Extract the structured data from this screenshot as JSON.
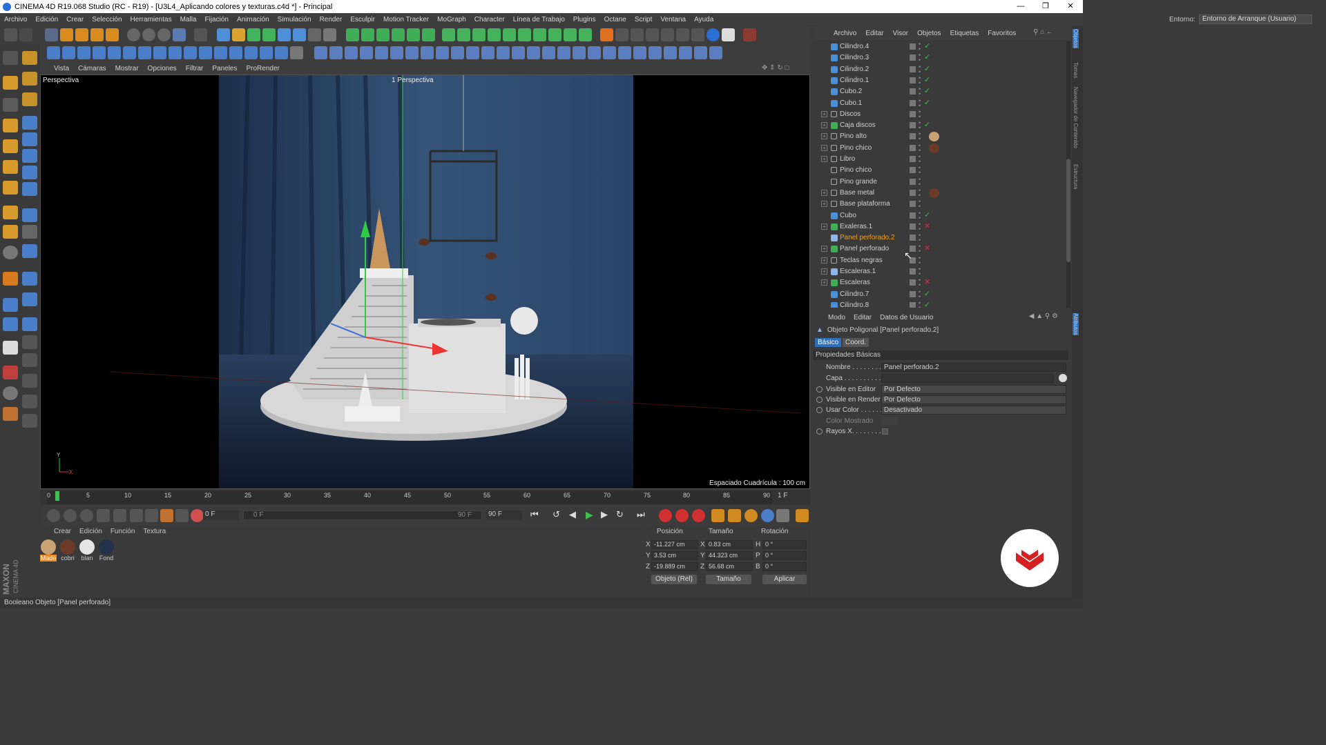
{
  "title": "CINEMA 4D R19.068 Studio (RC - R19) - [U3L4_Aplicando colores y texturas.c4d *] - Principal",
  "menu": [
    "Archivo",
    "Edición",
    "Crear",
    "Selección",
    "Herramientas",
    "Malla",
    "Fijación",
    "Animación",
    "Simulación",
    "Render",
    "Esculpir",
    "Motion Tracker",
    "MoGraph",
    "Character",
    "Línea de Trabajo",
    "Plugins",
    "Octane",
    "Script",
    "Ventana",
    "Ayuda"
  ],
  "env": {
    "label": "Entorno:",
    "value": "Entorno de Arranque (Usuario)"
  },
  "viewport_menu": [
    "Vista",
    "Cámaras",
    "Mostrar",
    "Opciones",
    "Filtrar",
    "Paneles",
    "ProRender"
  ],
  "viewport": {
    "name": "Perspectiva",
    "camera": "1 Perspectiva",
    "grid": "Espaciado Cuadrícula : 100 cm"
  },
  "timeline": {
    "ticks": [
      "0",
      "5",
      "10",
      "15",
      "20",
      "25",
      "30",
      "35",
      "40",
      "45",
      "50",
      "55",
      "60",
      "65",
      "70",
      "75",
      "80",
      "85",
      "90"
    ],
    "current": "1 F"
  },
  "transport": {
    "start": "0 F",
    "range_start": "0 F",
    "range_end": "90 F",
    "end": "90 F"
  },
  "materials": {
    "menu": [
      "Crear",
      "Edición",
      "Función",
      "Textura"
    ],
    "items": [
      {
        "label": "Made",
        "color": "#c9a274"
      },
      {
        "label": "cobri",
        "color": "#6b3a28"
      },
      {
        "label": "blan",
        "color": "#e4e4e4"
      },
      {
        "label": "Fond",
        "color": "#22324c"
      }
    ]
  },
  "coords": {
    "headers": [
      "Posición",
      "Tamaño",
      "Rotación"
    ],
    "rows": [
      {
        "axis": "X",
        "pos": "-11.227 cm",
        "saxis": "X",
        "size": "0.83 cm",
        "raxis": "H",
        "rot": "0 °"
      },
      {
        "axis": "Y",
        "pos": "3.53 cm",
        "saxis": "Y",
        "size": "44.323 cm",
        "raxis": "P",
        "rot": "0 °"
      },
      {
        "axis": "Z",
        "pos": "-19.889 cm",
        "saxis": "Z",
        "size": "56.68 cm",
        "raxis": "B",
        "rot": "0 °"
      }
    ],
    "mode": "Objeto (Rel)",
    "size_mode": "Tamaño",
    "apply": "Aplicar"
  },
  "status": "Booleano Objeto [Panel perforado]",
  "objects": {
    "menu": [
      "Archivo",
      "Editar",
      "Visor",
      "Objetos",
      "Etiquetas",
      "Favoritos"
    ],
    "items": [
      {
        "name": "Cilindro.4",
        "type": "prim",
        "exp": false,
        "tag": "check"
      },
      {
        "name": "Cilindro.3",
        "type": "prim",
        "exp": false,
        "tag": "check"
      },
      {
        "name": "Cilindro.2",
        "type": "prim",
        "exp": false,
        "tag": "check"
      },
      {
        "name": "Cilindro.1",
        "type": "prim",
        "exp": false,
        "tag": "check"
      },
      {
        "name": "Cubo.2",
        "type": "prim",
        "exp": false,
        "tag": "check"
      },
      {
        "name": "Cubo.1",
        "type": "prim",
        "exp": false,
        "tag": "check"
      },
      {
        "name": "Discos",
        "type": "null",
        "exp": true,
        "tag": ""
      },
      {
        "name": "Caja discos",
        "type": "gen",
        "exp": true,
        "tag": "check"
      },
      {
        "name": "Pino alto",
        "type": "null",
        "exp": true,
        "tag": "",
        "thumb": "#c9a274"
      },
      {
        "name": "Pino chico",
        "type": "null",
        "exp": true,
        "tag": "",
        "thumb": "#6b3a28"
      },
      {
        "name": "Libro",
        "type": "null",
        "exp": true,
        "tag": ""
      },
      {
        "name": "Pino chico",
        "type": "null",
        "exp": false,
        "tag": ""
      },
      {
        "name": "Pino grande",
        "type": "null",
        "exp": false,
        "tag": ""
      },
      {
        "name": "Base metal",
        "type": "null",
        "exp": true,
        "tag": "",
        "thumb": "#6b3a28"
      },
      {
        "name": "Base plataforma",
        "type": "null",
        "exp": true,
        "tag": ""
      },
      {
        "name": "Cubo",
        "type": "prim",
        "exp": false,
        "tag": "check"
      },
      {
        "name": "Exaleras.1",
        "type": "gen",
        "exp": true,
        "tag": "cross"
      },
      {
        "name": "Panel perforado.2",
        "type": "poly",
        "exp": false,
        "tag": "",
        "selected": true
      },
      {
        "name": "Panel perforado",
        "type": "bool",
        "exp": true,
        "tag": "cross"
      },
      {
        "name": "Teclas negras",
        "type": "null",
        "exp": true,
        "tag": ""
      },
      {
        "name": "Escaleras.1",
        "type": "poly",
        "exp": true,
        "tag": ""
      },
      {
        "name": "Escaleras",
        "type": "gen",
        "exp": true,
        "tag": "cross"
      },
      {
        "name": "Cilindro.7",
        "type": "prim",
        "exp": false,
        "tag": "check"
      },
      {
        "name": "Cilindro.8",
        "type": "prim",
        "exp": false,
        "tag": "check"
      }
    ]
  },
  "attributes": {
    "menu": [
      "Modo",
      "Editar",
      "Datos de Usuario"
    ],
    "object": "Objeto Poligonal [Panel perforado.2]",
    "tabs": [
      "Básico",
      "Coord."
    ],
    "section": "Propiedades Básicas",
    "fields": [
      {
        "label": "Nombre . . . . . . . . .",
        "value": "Panel perforado.2",
        "radio": false
      },
      {
        "label": "Capa . . . . . . . . . . .",
        "value": "",
        "radio": false
      },
      {
        "label": "Visible en Editor",
        "value": "Por Defecto",
        "radio": true
      },
      {
        "label": "Visible en Render",
        "value": "Por Defecto",
        "radio": true
      },
      {
        "label": "Usar Color . . . . . .",
        "value": "Desactivado",
        "radio": true
      },
      {
        "label": "Color Mostrado",
        "value": "",
        "radio": false
      },
      {
        "label": "Rayos X. . . . . . . . .",
        "value": "",
        "radio": true
      }
    ]
  },
  "side_tabs": [
    "Objetos",
    "Tomas",
    "Navegador de Contenido",
    "Estructura",
    "Atributos"
  ],
  "brand": {
    "maxon": "MAXON",
    "c4d": "CINEMA 4D"
  },
  "colors": {
    "accent": "#f2a020",
    "selection": "#2d6fb8",
    "bg": "#3a3a3a",
    "logo_red": "#d42020"
  }
}
